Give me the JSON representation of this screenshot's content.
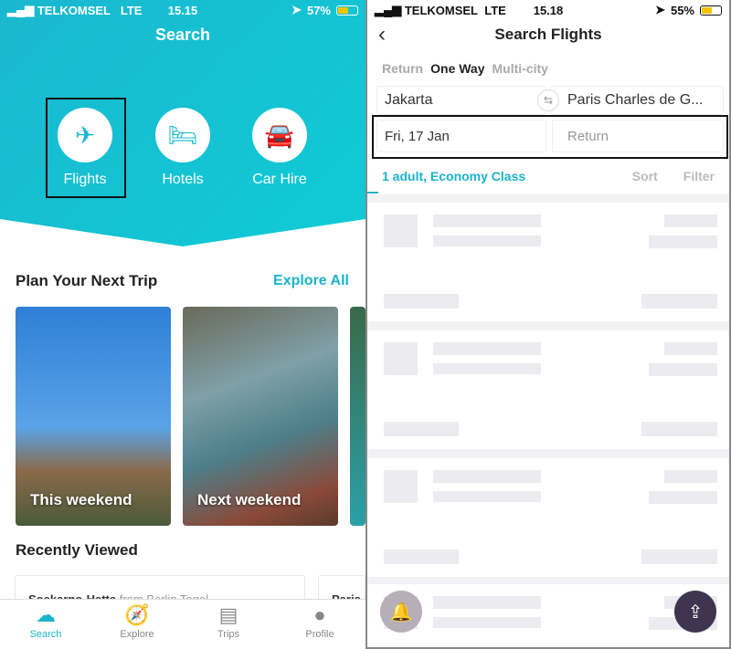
{
  "left": {
    "status": {
      "carrier": "TELKOMSEL",
      "network": "LTE",
      "time": "15.15",
      "battery": "57%"
    },
    "title": "Search",
    "categories": [
      {
        "label": "Flights",
        "icon": "airplane-icon"
      },
      {
        "label": "Hotels",
        "icon": "bed-icon"
      },
      {
        "label": "Car Hire",
        "icon": "car-icon"
      }
    ],
    "plan_title": "Plan Your Next Trip",
    "explore_all": "Explore All",
    "trips": [
      {
        "label": "This weekend"
      },
      {
        "label": "Next weekend"
      }
    ],
    "recent_title": "Recently Viewed",
    "recent": [
      {
        "to": "Soekarno-Hatta",
        "from": "from Berlin Tegel"
      },
      {
        "to": "Paris",
        "from": ""
      }
    ],
    "tabs": [
      {
        "label": "Search",
        "icon": "skyscanner-logo-icon"
      },
      {
        "label": "Explore",
        "icon": "compass-icon"
      },
      {
        "label": "Trips",
        "icon": "trips-icon"
      },
      {
        "label": "Profile",
        "icon": "profile-icon"
      }
    ],
    "accent": "#1ab3cc"
  },
  "right": {
    "status": {
      "carrier": "TELKOMSEL",
      "network": "LTE",
      "time": "15.18",
      "battery": "55%"
    },
    "title": "Search Flights",
    "modes": [
      "Return",
      "One Way",
      "Multi-city"
    ],
    "active_mode": "One Way",
    "origin": "Jakarta",
    "destination": "Paris Charles de G...",
    "depart_date": "Fri, 17 Jan",
    "return_placeholder": "Return",
    "passengers": "1 adult, Economy Class",
    "sort": "Sort",
    "filter": "Filter"
  }
}
